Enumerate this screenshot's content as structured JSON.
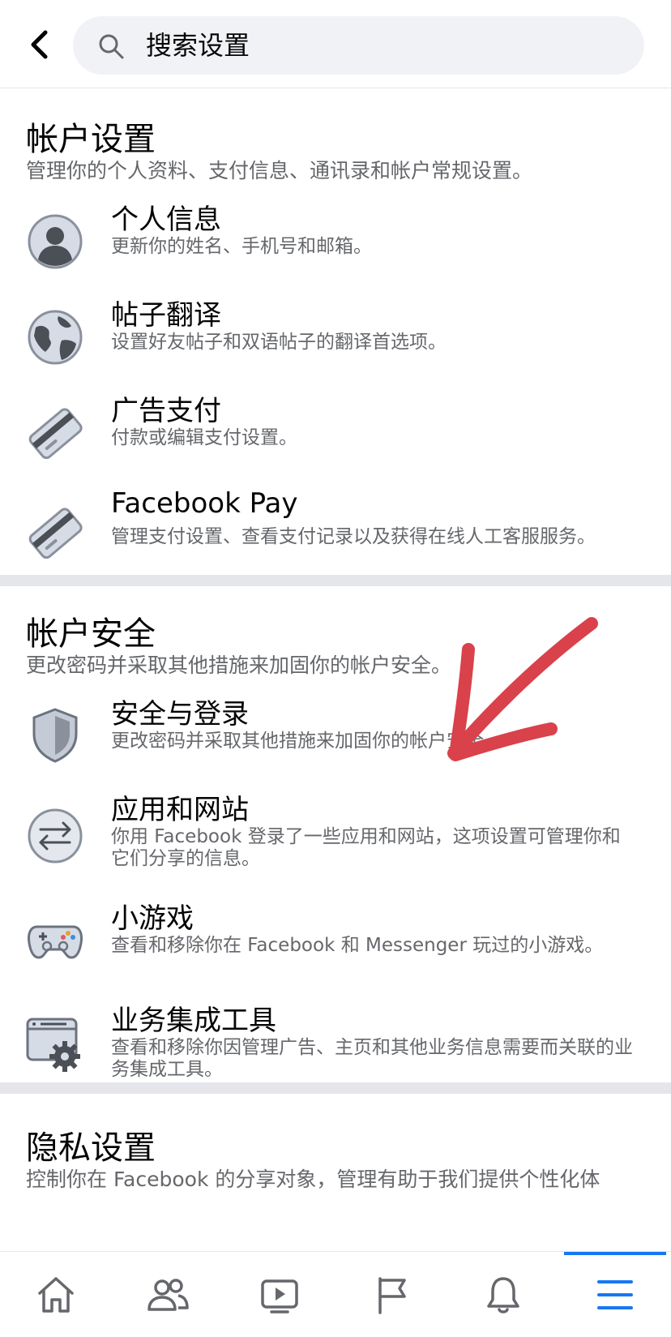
{
  "header": {
    "back_icon": "chevron-left-icon",
    "search_icon": "search-icon",
    "search_text": "搜索设置"
  },
  "sections": {
    "account_settings": {
      "title": "帐户设置",
      "description": "管理你的个人资料、支付信息、通讯录和帐户常规设置。",
      "items": [
        {
          "title": "个人信息",
          "description": "更新你的姓名、手机号和邮箱。",
          "icon": "person-icon"
        },
        {
          "title": "帖子翻译",
          "description": "设置好友帖子和双语帖子的翻译首选项。",
          "icon": "globe-icon"
        },
        {
          "title": "广告支付",
          "description": "付款或编辑支付设置。",
          "icon": "credit-card-icon"
        },
        {
          "title": "Facebook Pay",
          "description": "管理支付设置、查看支付记录以及获得在线人工客服服务。",
          "icon": "credit-card-icon"
        }
      ]
    },
    "account_security": {
      "title": "帐户安全",
      "description": "更改密码并采取其他措施来加固你的帐户安全。",
      "items": [
        {
          "title": "安全与登录",
          "description": "更改密码并采取其他措施来加固你的帐户安全。",
          "icon": "shield-icon"
        },
        {
          "title": "应用和网站",
          "description": "你用 Facebook 登录了一些应用和网站，这项设置可管理你和它们分享的信息。",
          "icon": "swap-arrows-icon"
        },
        {
          "title": "小游戏",
          "description": "查看和移除你在 Facebook 和 Messenger 玩过的小游戏。",
          "icon": "gamepad-icon"
        },
        {
          "title": "业务集成工具",
          "description": "查看和移除你因管理广告、主页和其他业务信息需要而关联的业务集成工具。",
          "icon": "window-gear-icon"
        }
      ]
    },
    "privacy_settings": {
      "title": "隐私设置",
      "description": "控制你在 Facebook 的分享对象，管理有助于我们提供个性化体"
    }
  },
  "annotation": {
    "color": "#d9414b",
    "icon": "red-arrow-annotation"
  },
  "bottom_nav": {
    "tabs": [
      "home-icon",
      "friends-icon",
      "video-icon",
      "pages-flag-icon",
      "notifications-bell-icon",
      "menu-icon"
    ],
    "active_index": 5,
    "active_color": "#1877f2",
    "icon_color": "#65676b"
  }
}
